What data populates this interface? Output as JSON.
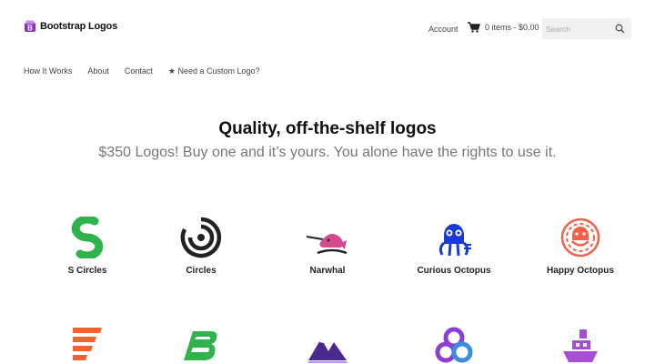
{
  "brand": {
    "name": "Bootstrap Logos",
    "mark_color": "#8b2fc9"
  },
  "header": {
    "account_label": "Account",
    "cart_label": "0 items - $0.00",
    "search_placeholder": "Search",
    "icons": {
      "cart": "cart-icon",
      "search": "search-icon"
    }
  },
  "nav": {
    "items": [
      {
        "label": "How It Works"
      },
      {
        "label": "About"
      },
      {
        "label": "Contact"
      },
      {
        "label": "★ Need a Custom Logo?"
      }
    ]
  },
  "hero": {
    "title": "Quality, off-the-shelf logos",
    "subtitle": "$350 Logos! Buy one and it’s yours. You alone have the rights to use it."
  },
  "logos": [
    {
      "name": "S Circles",
      "icon": "s-circles-logo",
      "color": "#2fb34a"
    },
    {
      "name": "Circles",
      "icon": "circles-logo",
      "color": "#222222"
    },
    {
      "name": "Narwhal",
      "icon": "narwhal-logo",
      "color": "#d6498f"
    },
    {
      "name": "Curious Octopus",
      "icon": "curious-octopus-logo",
      "color": "#1a3ad6"
    },
    {
      "name": "Happy Octopus",
      "icon": "happy-octopus-logo",
      "color": "#f0634a"
    },
    {
      "name": "",
      "icon": "stacked-f-logo",
      "color": "#f2622e"
    },
    {
      "name": "",
      "icon": "b-lines-logo",
      "color": "#2fb34a"
    },
    {
      "name": "",
      "icon": "mountains-logo",
      "color": "#4a2a8c"
    },
    {
      "name": "",
      "icon": "rings-logo",
      "color": "#8b3fd6"
    },
    {
      "name": "",
      "icon": "ship-logo",
      "color": "#a64fd6"
    }
  ]
}
